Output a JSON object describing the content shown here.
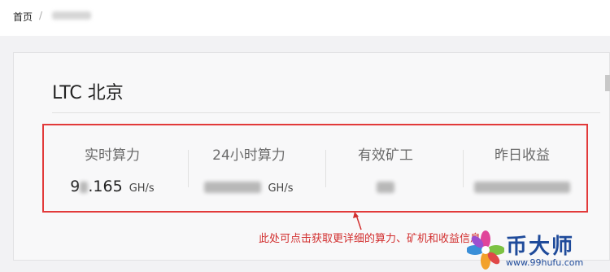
{
  "breadcrumb": {
    "home": "首页",
    "separator": "/"
  },
  "card": {
    "title": "LTC 北京"
  },
  "stats": [
    {
      "label": "实时算力",
      "value_prefix": "9",
      "value_suffix": ".165",
      "unit": "GH/s"
    },
    {
      "label": "24小时算力",
      "unit": "GH/s"
    },
    {
      "label": "有效矿工"
    },
    {
      "label": "昨日收益"
    }
  ],
  "annotation": "此处可点击获取更详细的算力、矿机和收益信息",
  "watermark": {
    "name": "币大师",
    "url": "www.99hufu.com"
  },
  "colors": {
    "highlight": "#e23a3a",
    "watermark": "#1e4a9a"
  }
}
